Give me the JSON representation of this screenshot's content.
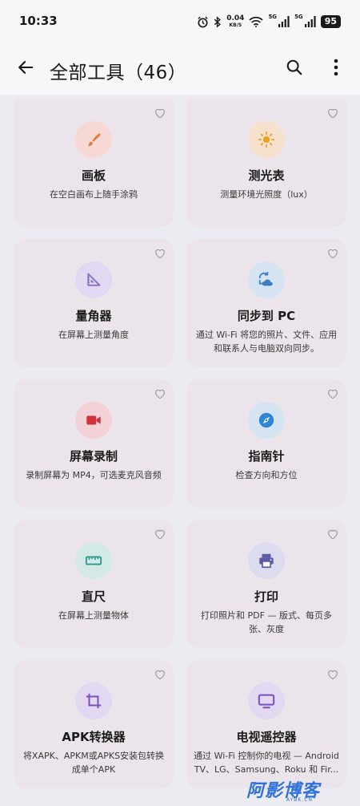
{
  "status_bar": {
    "time": "10:33",
    "net_speed_value": "0.04",
    "net_speed_unit": "KB/S",
    "signal1_label": "5G",
    "signal2_label": "5G",
    "battery": "95"
  },
  "app_bar": {
    "title": "全部工具（46）",
    "back_icon": "arrow-left-icon",
    "search_icon": "search-icon",
    "more_icon": "more-vert-icon"
  },
  "tools": [
    {
      "title": "画板",
      "desc": "在空白画布上随手涂鸦",
      "icon": "brush-icon",
      "color": "#E8773A"
    },
    {
      "title": "测光表",
      "desc": "测量环境光照度（lux）",
      "icon": "sun-icon",
      "color": "#F0A020"
    },
    {
      "title": "量角器",
      "desc": "在屏幕上测量角度",
      "icon": "set-square-icon",
      "color": "#8A6FC8"
    },
    {
      "title": "同步到 PC",
      "desc": "通过 Wi-Fi 将您的照片、文件、应用和联系人与电脑双向同步。",
      "icon": "sync-cloud-icon",
      "color": "#3C7FC0"
    },
    {
      "title": "屏幕录制",
      "desc": "录制屏幕为 MP4，可选麦克风音频",
      "icon": "video-camera-icon",
      "color": "#D4303C"
    },
    {
      "title": "指南针",
      "desc": "检查方向和方位",
      "icon": "compass-icon",
      "color": "#2F86D6"
    },
    {
      "title": "直尺",
      "desc": "在屏幕上测量物体",
      "icon": "ruler-icon",
      "color": "#2A9A8E"
    },
    {
      "title": "打印",
      "desc": "打印照片和 PDF — 版式、每页多张、灰度",
      "icon": "printer-icon",
      "color": "#5A5AA8"
    },
    {
      "title": "APK转换器",
      "desc": "将XAPK、APKM或APKS安装包转换成单个APK",
      "icon": "crop-icon",
      "color": "#7A4FC0"
    },
    {
      "title": "电视遥控器",
      "desc": "通过 Wi-Fi 控制你的电视 — Android TV、LG、Samsung、Roku 和 Fir...",
      "icon": "tv-icon",
      "color": "#7A4FC0"
    }
  ],
  "watermark": {
    "text": "阿影博客",
    "sub": "AYBK.CN"
  }
}
